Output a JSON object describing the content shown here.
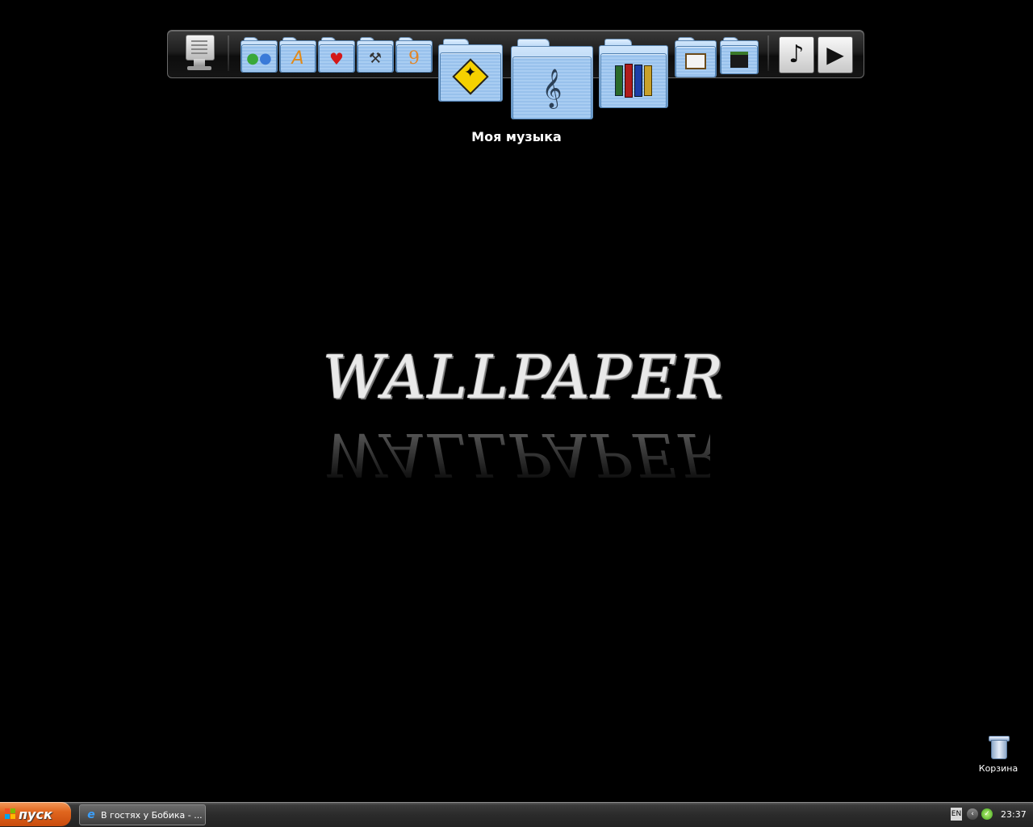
{
  "dock": {
    "items": [
      {
        "name": "system",
        "icon": "monitor-icon"
      },
      {
        "name": "folder-messenger",
        "icon": "messenger-people-icon"
      },
      {
        "name": "folder-applications",
        "icon": "applications-a-icon"
      },
      {
        "name": "folder-favorites",
        "icon": "heart-icon"
      },
      {
        "name": "folder-tools",
        "icon": "hammer-icon"
      },
      {
        "name": "folder-nine",
        "icon": "nine-icon",
        "glyph": "9"
      },
      {
        "name": "folder-public",
        "icon": "pedestrian-sign-icon"
      },
      {
        "name": "folder-music",
        "icon": "treble-clef-icon"
      },
      {
        "name": "folder-library",
        "icon": "books-icon"
      },
      {
        "name": "folder-pictures",
        "icon": "picture-frame-icon"
      },
      {
        "name": "folder-video",
        "icon": "film-clapper-icon"
      },
      {
        "name": "music-player",
        "icon": "music-note-icon"
      },
      {
        "name": "media-player",
        "icon": "play-icon"
      }
    ],
    "hover_label": "Моя музыка"
  },
  "wallpaper": {
    "text": "WALLPAPER"
  },
  "desktop": {
    "recycle_bin_label": "Корзина"
  },
  "taskbar": {
    "start_label": "пуск",
    "tasks": [
      {
        "label": "В гостях у Бобика - ..."
      }
    ],
    "tray": {
      "language": "EN",
      "time": "23:37"
    }
  },
  "colors": {
    "desktop_background": "#000000",
    "start_button": "#e0661f",
    "folder_blue": "#98c1ec",
    "taskbar": "#2b2b2b"
  }
}
